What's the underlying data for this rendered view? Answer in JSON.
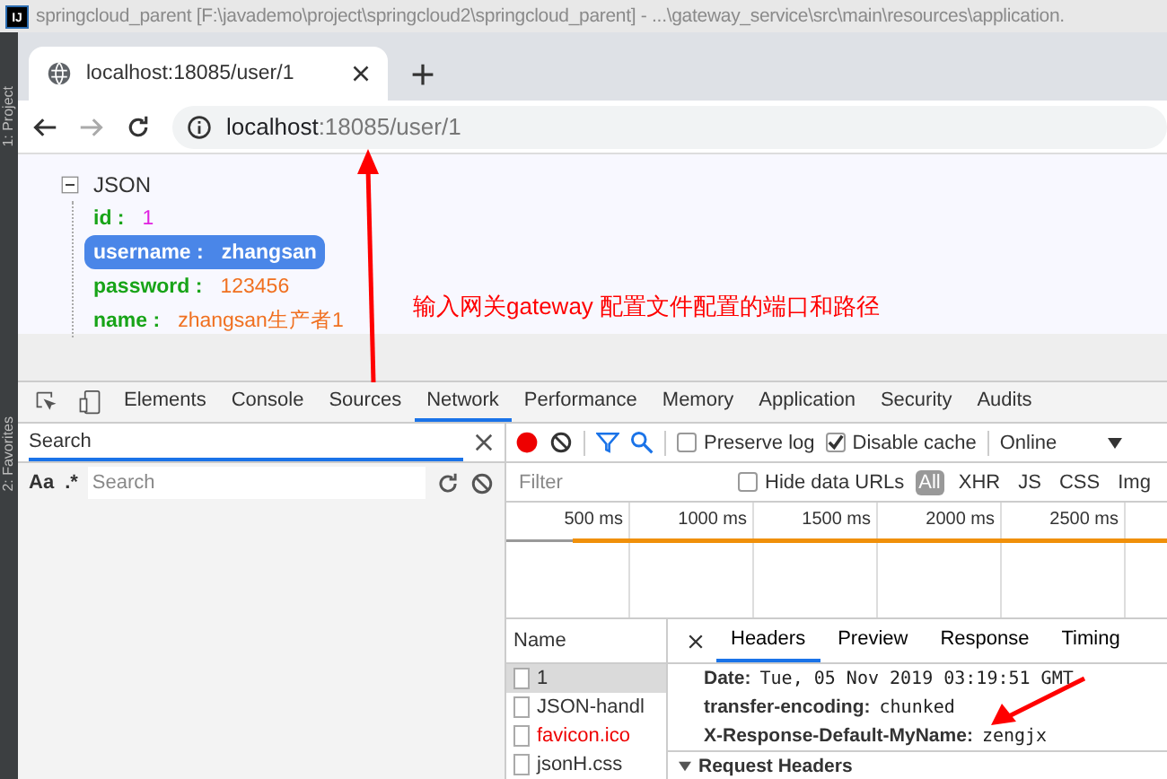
{
  "ide": {
    "title": "springcloud_parent [F:\\javademo\\project\\springcloud2\\springcloud_parent] - ...\\gateway_service\\src\\main\\resources\\application.",
    "logo": "IJ",
    "side_tabs": [
      "1: Project",
      "2: Favorites"
    ]
  },
  "browser": {
    "tab": {
      "title": "localhost:18085/user/1"
    },
    "url": {
      "host": "localhost",
      "rest": ":18085/user/1"
    }
  },
  "json_view": {
    "root": "JSON",
    "expanded": true,
    "fields": [
      {
        "key": "id :",
        "value": "1",
        "kind": "number",
        "selected": false
      },
      {
        "key": "username :",
        "value": "zhangsan",
        "kind": "string",
        "selected": true
      },
      {
        "key": "password :",
        "value": "123456",
        "kind": "string",
        "selected": false
      },
      {
        "key": "name :",
        "value": "zhangsan生产者1",
        "kind": "string",
        "selected": false
      }
    ]
  },
  "annotations": [
    {
      "text": "输入网关gateway 配置文件配置的端口和路径"
    }
  ],
  "devtools": {
    "tabs": [
      {
        "label": "Elements",
        "selected": false
      },
      {
        "label": "Console",
        "selected": false
      },
      {
        "label": "Sources",
        "selected": false
      },
      {
        "label": "Network",
        "selected": true
      },
      {
        "label": "Performance",
        "selected": false
      },
      {
        "label": "Memory",
        "selected": false
      },
      {
        "label": "Application",
        "selected": false
      },
      {
        "label": "Security",
        "selected": false
      },
      {
        "label": "Audits",
        "selected": false
      }
    ],
    "search": {
      "title": "Search",
      "case_label": "Aa",
      "regex_label": ".*",
      "placeholder": "Search"
    },
    "toolbar": {
      "recording": true,
      "preserve_log": {
        "label": "Preserve log",
        "checked": false
      },
      "disable_cache": {
        "label": "Disable cache",
        "checked": true
      },
      "throttle": "Online"
    },
    "filter": {
      "placeholder": "Filter",
      "hide_data_urls": {
        "label": "Hide data URLs",
        "checked": false
      },
      "types": [
        {
          "label": "All",
          "selected": true
        },
        {
          "label": "XHR",
          "selected": false
        },
        {
          "label": "JS",
          "selected": false
        },
        {
          "label": "CSS",
          "selected": false
        },
        {
          "label": "Img",
          "selected": false
        }
      ]
    },
    "timeline": {
      "ticks": [
        "500 ms",
        "1000 ms",
        "1500 ms",
        "2000 ms",
        "2500 ms"
      ]
    },
    "requests": {
      "header": "Name",
      "rows": [
        {
          "name": "1",
          "selected": true,
          "failed": false
        },
        {
          "name": "JSON-handl",
          "selected": false,
          "failed": false
        },
        {
          "name": "favicon.ico",
          "selected": false,
          "failed": true
        },
        {
          "name": "jsonH.css",
          "selected": false,
          "failed": false
        }
      ]
    },
    "detail_tabs": [
      {
        "label": "Headers",
        "selected": true
      },
      {
        "label": "Preview",
        "selected": false
      },
      {
        "label": "Response",
        "selected": false
      },
      {
        "label": "Timing",
        "selected": false
      }
    ],
    "headers": [
      {
        "name": "Date:",
        "value": "Tue, 05 Nov 2019 03:19:51 GMT"
      },
      {
        "name": "transfer-encoding:",
        "value": "chunked"
      },
      {
        "name": "X-Response-Default-MyName:",
        "value": "zengjx"
      }
    ],
    "section": {
      "title": "Request Headers",
      "expanded": true
    }
  }
}
